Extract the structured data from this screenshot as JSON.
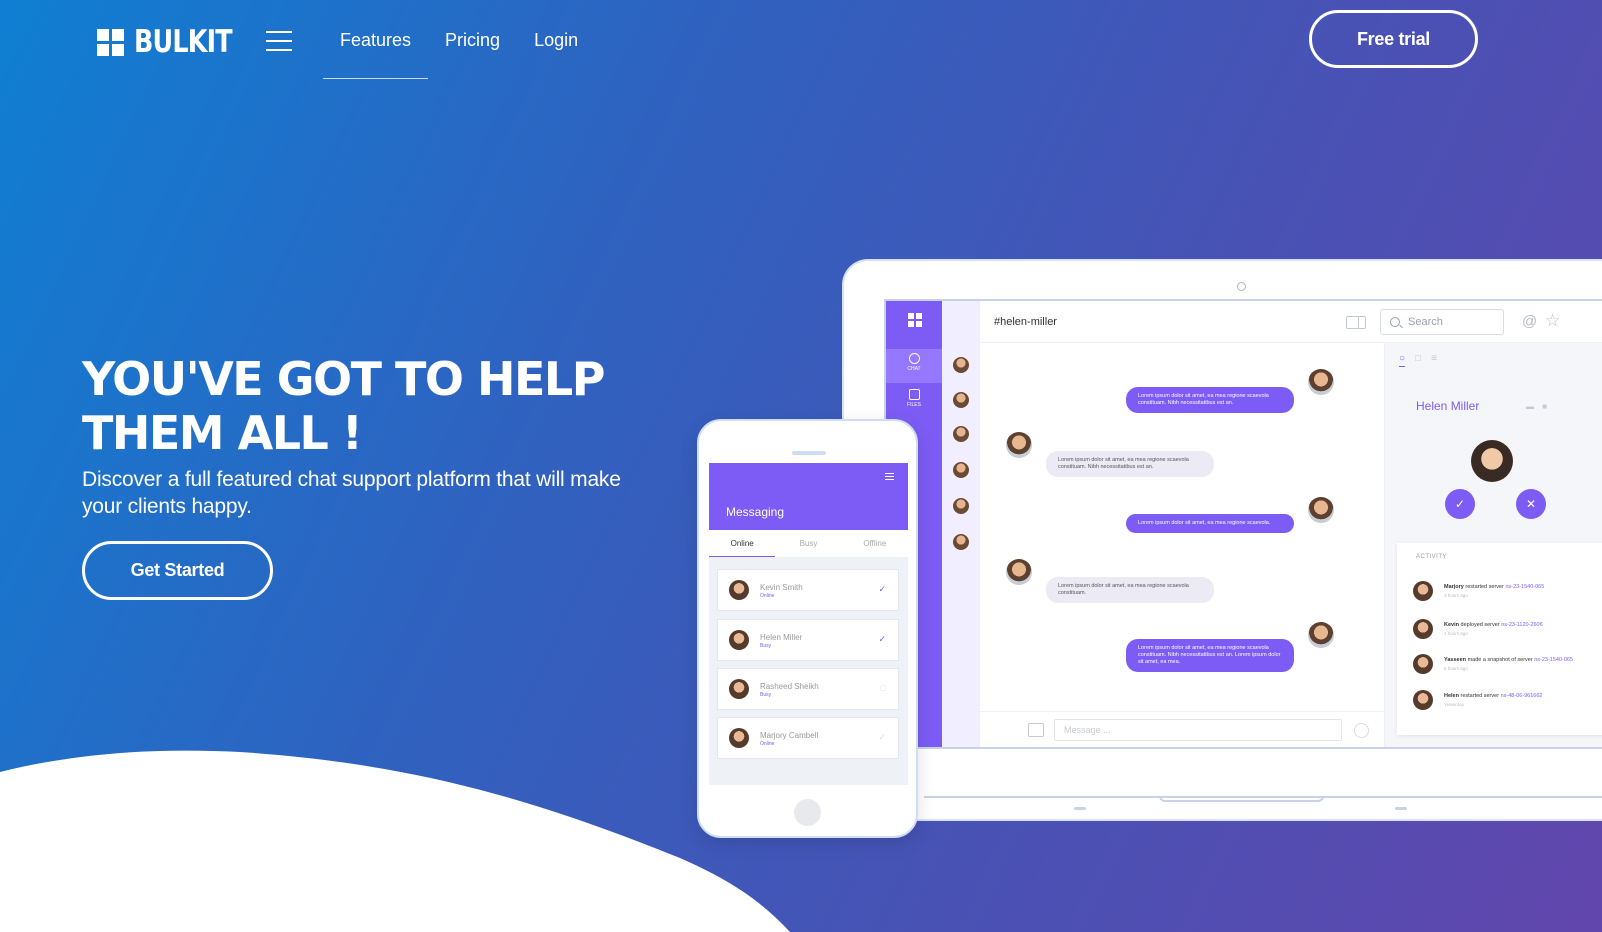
{
  "brand": {
    "name": "BULKIT"
  },
  "nav": {
    "links": [
      "Features",
      "Pricing",
      "Login"
    ],
    "active": "Features",
    "cta": "Free trial"
  },
  "hero": {
    "title_line1": "YOU'VE GOT TO HELP",
    "title_line2": "THEM ALL !",
    "subtitle": "Discover a full featured chat support platform that will make your clients happy.",
    "cta": "Get Started"
  },
  "colors": {
    "accent": "#7c5cf4",
    "gradient_start": "#0f7fd2",
    "gradient_end": "#6146ad"
  },
  "laptop_app": {
    "rail": {
      "chat_label": "CHAT",
      "files_label": "FILES"
    },
    "channel": "#helen-miller",
    "search_placeholder": "Search",
    "messages": [
      {
        "dir": "out",
        "text": "Lorem ipsum dolor sit amet, ea mea regione scaevola constituam. Nibh necessitatibus est an."
      },
      {
        "dir": "in",
        "text": "Lorem ipsum dolor sit amet, ea mea regione scaevola constituam. Nibh necessitatibus est an."
      },
      {
        "dir": "out",
        "text": "Lorem ipsum dolor sit amet, ea mea regione scaevola."
      },
      {
        "dir": "in",
        "text": "Lorem ipsum dolor sit amet, ea mea regione scaevola constituam."
      },
      {
        "dir": "out",
        "text": "Lorem ipsum dolor sit amet, ea mea regione scaevola constituam. Nibh necessitatibus est an. Lorem ipsum dolor sit amet, ea mea."
      }
    ],
    "message_placeholder": "Message ...",
    "profile": {
      "name": "Helen Miller"
    },
    "activity": {
      "title": "ACTIVITY",
      "items": [
        {
          "who": "Marjory",
          "what": "restarted server",
          "ref": "ns-23-1540-065",
          "when": "3 hours ago"
        },
        {
          "who": "Kevin",
          "what": "deployed server",
          "ref": "ns-23-1120-2606",
          "when": "4 hours ago"
        },
        {
          "who": "Yasseen",
          "what": "made a snapshot of server",
          "ref": "ns-23-1540-065",
          "when": "5 hours ago"
        },
        {
          "who": "Helen",
          "what": "restarted server",
          "ref": "ns-48-06-961662",
          "when": "Yesterday"
        }
      ]
    }
  },
  "phone_app": {
    "title": "Messaging",
    "tabs": [
      "Online",
      "Busy",
      "Offline"
    ],
    "active_tab": "Online",
    "contacts": [
      {
        "name": "Kevin Smith",
        "status": "Online",
        "checked": true
      },
      {
        "name": "Helen Miller",
        "status": "Busy",
        "checked": true
      },
      {
        "name": "Rasheed Sheikh",
        "status": "Busy",
        "checked": false
      },
      {
        "name": "Marjory Cambell",
        "status": "Online",
        "checked": true
      }
    ]
  }
}
